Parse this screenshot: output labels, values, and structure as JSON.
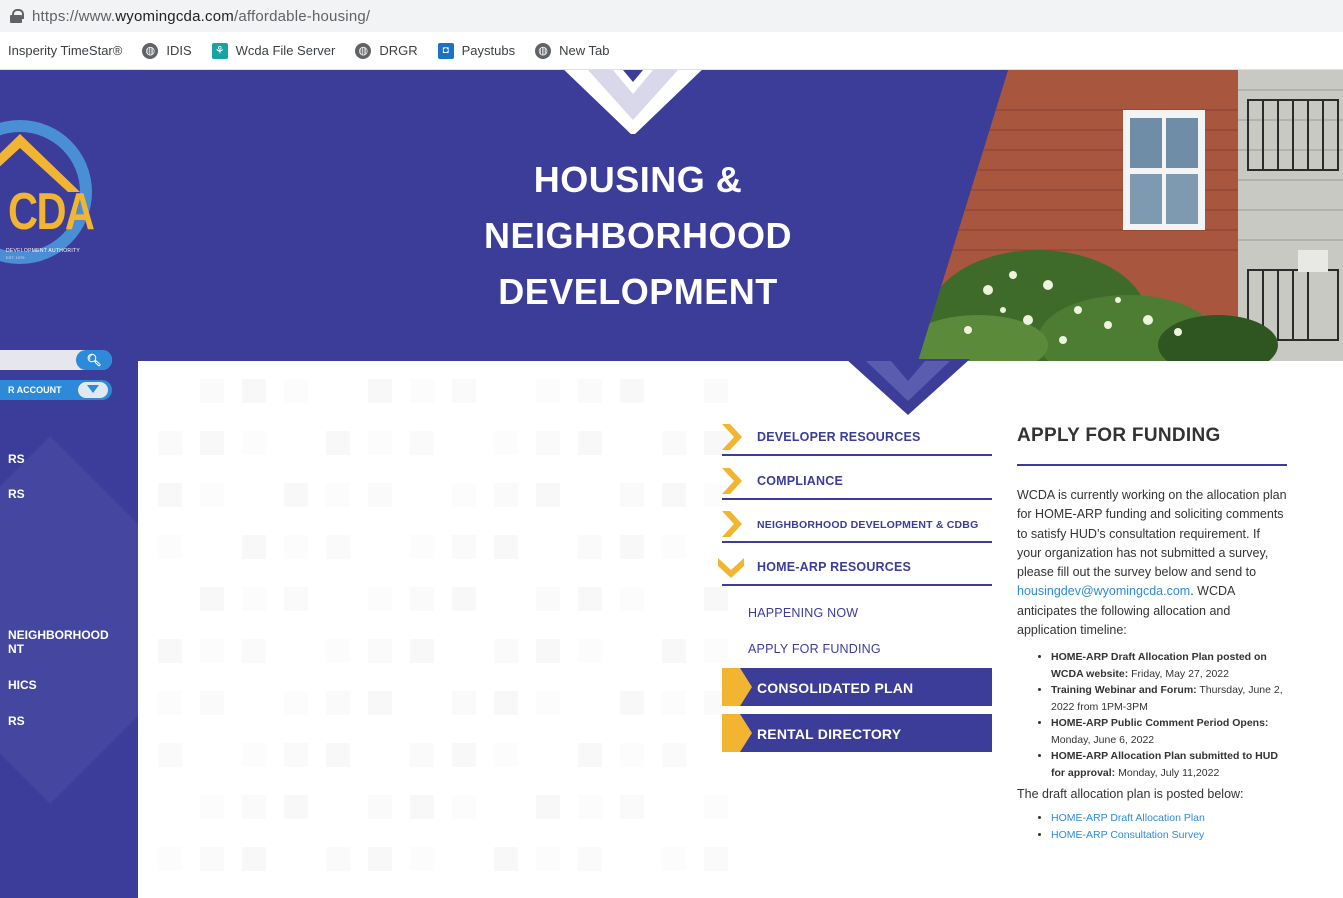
{
  "browser": {
    "url_prefix": "https://www.",
    "url_domain": "wyomingcda.com",
    "url_path": "/affordable-housing/",
    "bookmarks": [
      {
        "label": "Insperity TimeStar®",
        "icon": "none"
      },
      {
        "label": "IDIS",
        "icon": "globe-icon"
      },
      {
        "label": "Wcda File Server",
        "icon": "tree-icon"
      },
      {
        "label": "DRGR",
        "icon": "globe-icon"
      },
      {
        "label": "Paystubs",
        "icon": "paystubs-icon"
      },
      {
        "label": "New Tab",
        "icon": "globe-icon"
      }
    ]
  },
  "sidebar": {
    "logo_text": "CDA",
    "logo_subtitle": "DEVELOPMENT AUTHORITY",
    "logo_est": "EST. 1975",
    "account_label": "R ACCOUNT",
    "nav": [
      "RS",
      "RS",
      "NEIGHBORHOOD",
      "NT",
      "HICS",
      "RS"
    ]
  },
  "hero": {
    "title_line1": "HOUSING &",
    "title_line2": "NEIGHBORHOOD",
    "title_line3": "DEVELOPMENT"
  },
  "menu": {
    "items": [
      {
        "label": "DEVELOPER RESOURCES",
        "expanded": false
      },
      {
        "label": "COMPLIANCE",
        "expanded": false
      },
      {
        "label": "NEIGHBORHOOD DEVELOPMENT & CDBG",
        "expanded": false
      },
      {
        "label": "HOME-ARP RESOURCES",
        "expanded": true
      }
    ],
    "sub_links": [
      "HAPPENING NOW",
      "APPLY FOR FUNDING"
    ],
    "buttons": [
      "CONSOLIDATED PLAN",
      "RENTAL DIRECTORY"
    ]
  },
  "article": {
    "title": "APPLY FOR FUNDING",
    "intro_before_link": "WCDA is currently working on the allocation plan for HOME-ARP funding and soliciting comments to satisfy HUD’s consultation requirement. If your organization has not submitted a survey, please fill out the survey below and send to ",
    "email": "housingdev@wyomingcda.com",
    "intro_after_link": ". WCDA anticipates the following allocation and application timeline:",
    "timeline": [
      {
        "label": "HOME-ARP Draft Allocation Plan posted on WCDA website:",
        "value": " Friday, May 27, 2022"
      },
      {
        "label": "Training Webinar and Forum:",
        "value": " Thursday, June 2, 2022 from 1PM-3PM"
      },
      {
        "label": "HOME-ARP Public Comment Period Opens:",
        "value": " Monday, June 6, 2022"
      },
      {
        "label": "HOME-ARP Allocation Plan submitted to HUD for approval:",
        "value": " Monday, July 11,2022"
      }
    ],
    "posted_note": "The draft allocation plan is posted below:",
    "links": [
      "HOME-ARP Draft Allocation Plan",
      "HOME-ARP Consultation Survey"
    ]
  },
  "colors": {
    "brand_blue": "#3b3d98",
    "accent_gold": "#f2b531",
    "link_blue": "#2e8ad8"
  }
}
